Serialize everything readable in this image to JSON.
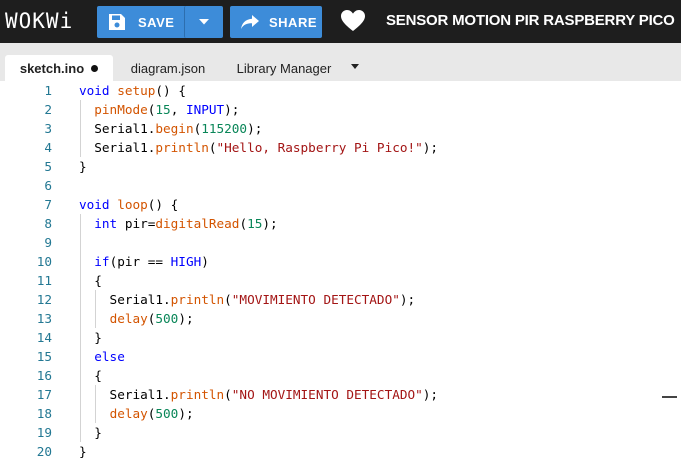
{
  "header": {
    "logo": "WOKWi",
    "save_label": "SAVE",
    "share_label": "SHARE",
    "project_title": "SENSOR MOTION PIR RASPBERRY PICO",
    "accent_color": "#3d8cd9"
  },
  "tabs": [
    {
      "label": "sketch.ino",
      "active": true,
      "unsaved": true
    },
    {
      "label": "diagram.json",
      "active": false
    },
    {
      "label": "Library Manager",
      "active": false
    }
  ],
  "editor": {
    "line_numbers": [
      "1",
      "2",
      "3",
      "4",
      "5",
      "6",
      "7",
      "8",
      "9",
      "10",
      "11",
      "12",
      "13",
      "14",
      "15",
      "16",
      "17",
      "18",
      "19",
      "20"
    ],
    "lines": [
      [
        {
          "t": "void",
          "c": "kw"
        },
        {
          "t": " "
        },
        {
          "t": "setup",
          "c": "ard"
        },
        {
          "t": "() {"
        }
      ],
      [
        {
          "t": "  "
        },
        {
          "t": "pinMode",
          "c": "ard"
        },
        {
          "t": "("
        },
        {
          "t": "15",
          "c": "num"
        },
        {
          "t": ", "
        },
        {
          "t": "INPUT",
          "c": "kw"
        },
        {
          "t": ");"
        }
      ],
      [
        {
          "t": "  Serial1."
        },
        {
          "t": "begin",
          "c": "ard"
        },
        {
          "t": "("
        },
        {
          "t": "115200",
          "c": "num"
        },
        {
          "t": ");"
        }
      ],
      [
        {
          "t": "  Serial1."
        },
        {
          "t": "println",
          "c": "ard"
        },
        {
          "t": "("
        },
        {
          "t": "\"Hello, Raspberry Pi Pico!\"",
          "c": "str"
        },
        {
          "t": ");"
        }
      ],
      [
        {
          "t": "}"
        }
      ],
      [
        {
          "t": ""
        }
      ],
      [
        {
          "t": "void",
          "c": "kw"
        },
        {
          "t": " "
        },
        {
          "t": "loop",
          "c": "ard"
        },
        {
          "t": "() {"
        }
      ],
      [
        {
          "t": "  "
        },
        {
          "t": "int",
          "c": "kw"
        },
        {
          "t": " pir="
        },
        {
          "t": "digitalRead",
          "c": "ard"
        },
        {
          "t": "("
        },
        {
          "t": "15",
          "c": "num"
        },
        {
          "t": ");"
        }
      ],
      [
        {
          "t": ""
        }
      ],
      [
        {
          "t": "  "
        },
        {
          "t": "if",
          "c": "kw"
        },
        {
          "t": "(pir == "
        },
        {
          "t": "HIGH",
          "c": "kw"
        },
        {
          "t": ")"
        }
      ],
      [
        {
          "t": "  {"
        }
      ],
      [
        {
          "t": "    Serial1."
        },
        {
          "t": "println",
          "c": "ard"
        },
        {
          "t": "("
        },
        {
          "t": "\"MOVIMIENTO DETECTADO\"",
          "c": "str"
        },
        {
          "t": ");"
        }
      ],
      [
        {
          "t": "    "
        },
        {
          "t": "delay",
          "c": "ard"
        },
        {
          "t": "("
        },
        {
          "t": "500",
          "c": "num"
        },
        {
          "t": ");"
        }
      ],
      [
        {
          "t": "  }"
        }
      ],
      [
        {
          "t": "  "
        },
        {
          "t": "else",
          "c": "kw"
        }
      ],
      [
        {
          "t": "  {"
        }
      ],
      [
        {
          "t": "    Serial1."
        },
        {
          "t": "println",
          "c": "ard"
        },
        {
          "t": "("
        },
        {
          "t": "\"NO MOVIMIENTO DETECTADO\"",
          "c": "str"
        },
        {
          "t": ");"
        }
      ],
      [
        {
          "t": "    "
        },
        {
          "t": "delay",
          "c": "ard"
        },
        {
          "t": "("
        },
        {
          "t": "500",
          "c": "num"
        },
        {
          "t": ");"
        }
      ],
      [
        {
          "t": "  }"
        }
      ],
      [
        {
          "t": "}"
        }
      ]
    ]
  }
}
